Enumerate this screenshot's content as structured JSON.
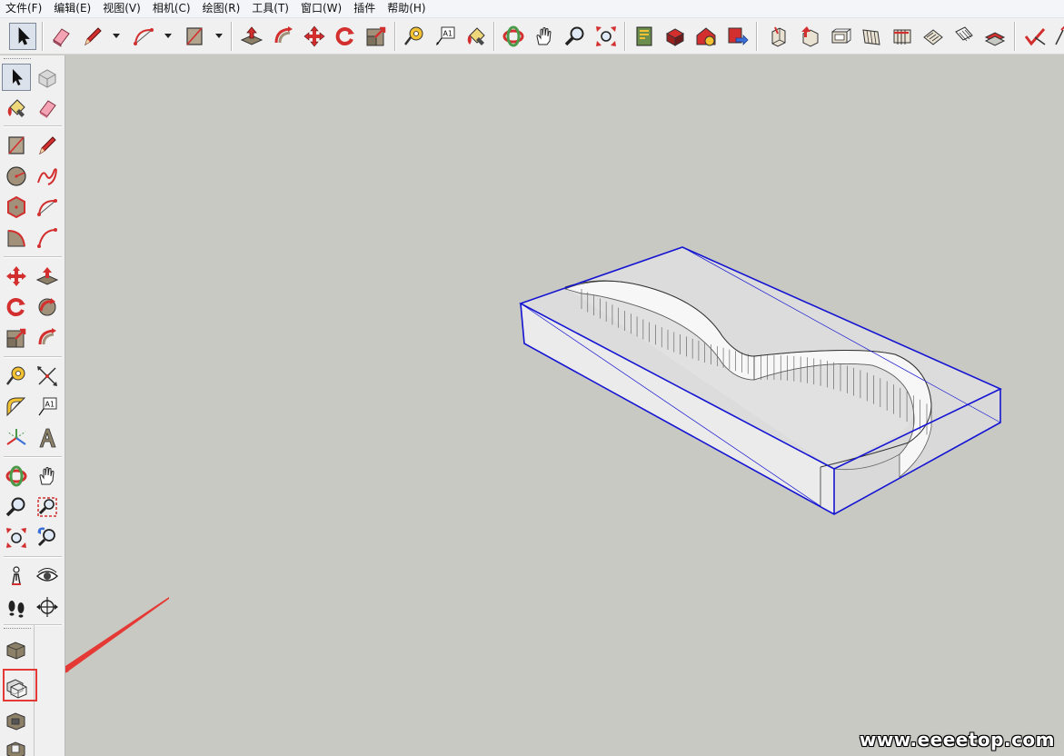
{
  "menu": [
    {
      "id": "file",
      "label": "文件(F)"
    },
    {
      "id": "edit",
      "label": "编辑(E)"
    },
    {
      "id": "view",
      "label": "视图(V)"
    },
    {
      "id": "camera",
      "label": "相机(C)"
    },
    {
      "id": "draw",
      "label": "绘图(R)"
    },
    {
      "id": "tools",
      "label": "工具(T)"
    },
    {
      "id": "window",
      "label": "窗口(W)"
    },
    {
      "id": "plugins",
      "label": "插件"
    },
    {
      "id": "help",
      "label": "帮助(H)"
    }
  ],
  "toolbar": {
    "tools": [
      "select-icon",
      "eraser-icon",
      "pencil-icon",
      "arc-icon",
      "rectangle-icon",
      "push-pull-icon",
      "follow-me-icon",
      "move-icon",
      "rotate-icon",
      "scale-icon",
      "tape-measure-icon",
      "text-icon",
      "paint-bucket-icon",
      "orbit-icon",
      "pan-icon",
      "zoom-icon",
      "zoom-extents-icon",
      "model-info-icon",
      "components-icon",
      "warehouse-icon",
      "share-model-icon",
      "iso-view-icon",
      "top-view-icon",
      "front-view-icon",
      "right-view-icon",
      "back-view-icon",
      "left-view-icon",
      "section-plane-icon",
      "section-display-icon",
      "check-icon",
      "sandbox-icon"
    ]
  },
  "lefttoolbar": {
    "tools": [
      "select-icon",
      "make-component-icon",
      "paint-bucket-icon",
      "eraser-icon",
      "rectangle-icon",
      "line-icon",
      "circle-icon",
      "freehand-icon",
      "polygon-icon",
      "arc-icon",
      "pie-icon",
      "two-point-arc-icon",
      "move-icon",
      "push-pull-icon",
      "rotate-icon",
      "follow-me-icon",
      "scale-icon",
      "offset-icon",
      "tape-measure-icon",
      "dimension-icon",
      "protractor-icon",
      "text-icon",
      "axes-icon",
      "3d-text-icon",
      "orbit-icon",
      "pan-icon",
      "zoom-icon",
      "zoom-window-icon",
      "zoom-extents-icon",
      "previous-view-icon",
      "position-camera-icon",
      "look-around-icon",
      "walk-icon",
      "section-plane-icon",
      "solid-outer-shell-icon",
      "solid-intersect-icon",
      "solid-union-icon",
      "solid-subtract-icon"
    ],
    "highlighted_tool": "solid-intersect-icon"
  },
  "viewport": {
    "background": "#c9c9c4",
    "selection_color": "#1414d2",
    "annotation_color": "#e53935"
  },
  "watermark": "www.eeeetop.com"
}
